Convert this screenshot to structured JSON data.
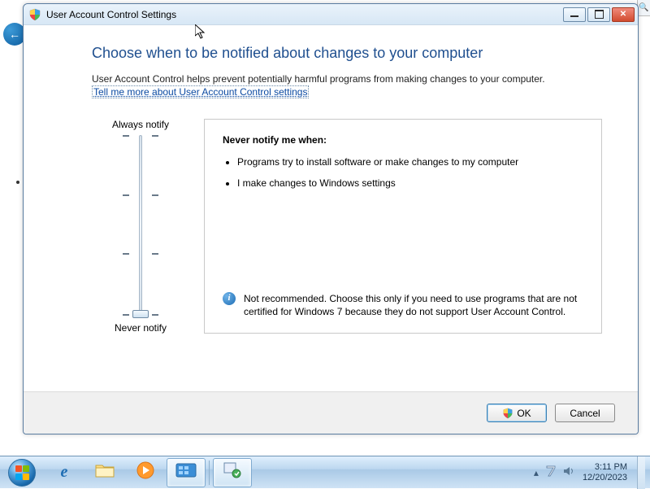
{
  "bg": {
    "search_icon": "🔍"
  },
  "window": {
    "title": "User Account Control Settings",
    "heading": "Choose when to be notified about changes to your computer",
    "intro": "User Account Control helps prevent potentially harmful programs from making changes to your computer.",
    "link": "Tell me more about User Account Control settings",
    "slider": {
      "top_label": "Always notify",
      "bottom_label": "Never notify",
      "levels": 4,
      "current_level": 0
    },
    "description": {
      "title": "Never notify me when:",
      "bullets": [
        "Programs try to install software or make changes to my computer",
        "I make changes to Windows settings"
      ],
      "warning": "Not recommended. Choose this only if you need to use programs that are not certified for Windows 7 because they do not support User Account Control."
    },
    "buttons": {
      "ok": "OK",
      "cancel": "Cancel"
    }
  },
  "taskbar": {
    "tray": {
      "time": "3:11 PM",
      "date": "12/20/2023"
    }
  }
}
